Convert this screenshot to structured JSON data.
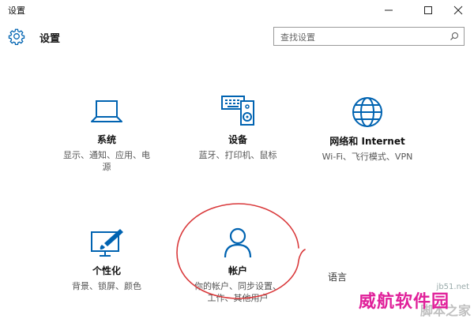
{
  "window": {
    "title": "设置"
  },
  "header": {
    "title": "设置"
  },
  "search": {
    "placeholder": "查找设置"
  },
  "tiles": [
    {
      "name": "系统",
      "desc_lines": [
        "显示、通知、应用、电",
        "源"
      ],
      "icon": "laptop-icon"
    },
    {
      "name": "设备",
      "desc_lines": [
        "蓝牙、打印机、鼠标"
      ],
      "icon": "keyboard-speaker-icon"
    },
    {
      "name": "网络和 Internet",
      "desc_lines": [
        "Wi-Fi、飞行模式、VPN"
      ],
      "icon": "globe-icon"
    },
    {
      "name": "个性化",
      "desc_lines": [
        "背景、锁屏、颜色"
      ],
      "icon": "paint-monitor-icon"
    },
    {
      "name": "帐户",
      "desc_lines": [
        "你的帐户、同步设置、",
        "工作、其他用户"
      ],
      "icon": "person-icon"
    },
    {
      "name": "语言",
      "desc_lines": [],
      "icon": "language-icon"
    }
  ],
  "watermark": {
    "main": "威航软件园",
    "sub": "脚本之家",
    "url": "jb51.net"
  },
  "colors": {
    "accent": "#0063b1",
    "annotation": "#d9383a",
    "watermark": "#e0209a"
  }
}
